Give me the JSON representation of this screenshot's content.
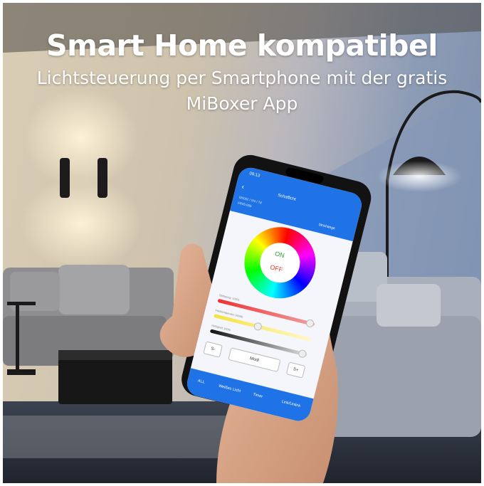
{
  "headline": "Smart Home kompatibel",
  "subheadline": {
    "line1": "Lichtsteuerung per Smartphone mit der gratis",
    "line2": "MiBoxer App"
  },
  "app": {
    "status_time": "09:13",
    "back_label": "‹",
    "screen_title": "Schaflicht",
    "action_label": "btnchange",
    "device_info": "0/0052 / 0/4 / 7d",
    "device_code": "FR05-005",
    "wheel_on_label": "ON",
    "wheel_off_label": "OFF",
    "slider_labels": {
      "brightness": "Sättigung: 100%",
      "color_temp": "Farbtemperatur 6400K",
      "intensity": "Helligkeit 100%"
    },
    "buttons": {
      "speed_down": "S-",
      "mode": "Modi",
      "speed_up": "S+"
    },
    "tabs": [
      "ALL",
      "Weißes Licht",
      "Timer",
      "Link/Unlink"
    ]
  },
  "colors": {
    "app_blue": "#1f73e6",
    "headline_text": "#ffffff"
  }
}
